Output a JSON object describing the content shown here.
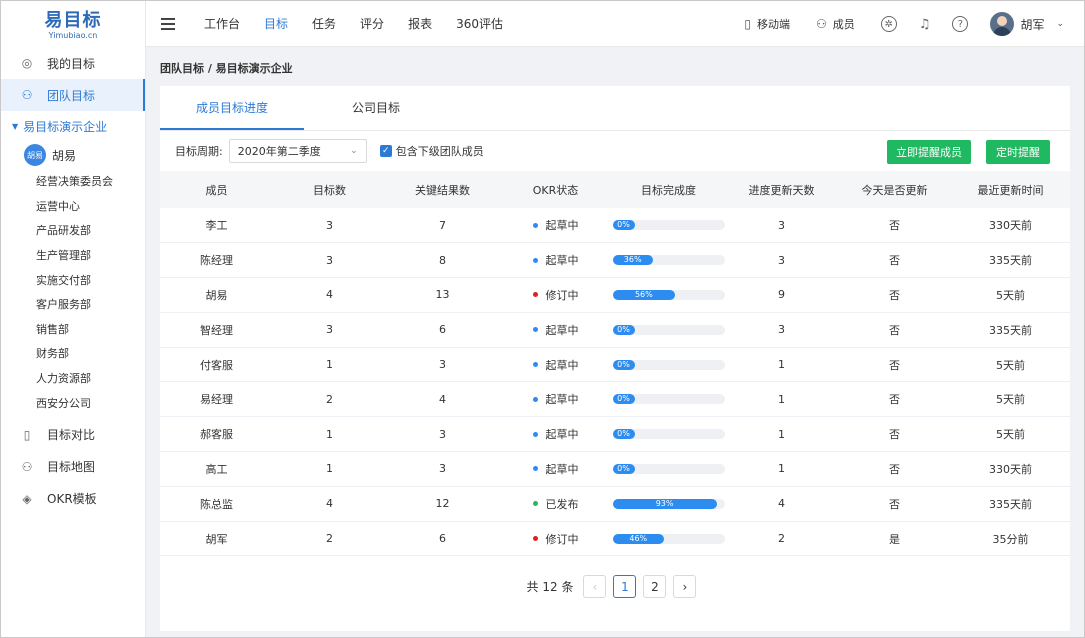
{
  "logo": {
    "title": "易目标",
    "subtitle": "Yimubiao.cn"
  },
  "sidebar": {
    "items_top": [
      {
        "label": "我的目标",
        "icon": "target-icon"
      },
      {
        "label": "团队目标",
        "icon": "team-icon"
      }
    ],
    "org": {
      "label": "易目标演示企业",
      "user_avatar": "胡易",
      "user_name": "胡易"
    },
    "departments": [
      "经营决策委员会",
      "运营中心",
      "产品研发部",
      "生产管理部",
      "实施交付部",
      "客户服务部",
      "销售部",
      "财务部",
      "人力资源部",
      "西安分公司"
    ],
    "items_bottom": [
      {
        "label": "目标对比",
        "icon": "book-icon"
      },
      {
        "label": "目标地图",
        "icon": "map-icon"
      },
      {
        "label": "OKR模板",
        "icon": "layers-icon"
      }
    ]
  },
  "topnav": [
    "工作台",
    "目标",
    "任务",
    "评分",
    "报表",
    "360评估"
  ],
  "topright": {
    "mobile": "移动端",
    "members": "成员",
    "user": "胡军"
  },
  "breadcrumb": "团队目标 / 易目标演示企业",
  "tabs": [
    "成员目标进度",
    "公司目标"
  ],
  "filter": {
    "label": "目标周期:",
    "period": "2020年第二季度",
    "checkbox": "包含下级团队成员",
    "btn_remind": "立即提醒成员",
    "btn_schedule": "定时提醒"
  },
  "table": {
    "headers": [
      "成员",
      "目标数",
      "关键结果数",
      "OKR状态",
      "目标完成度",
      "进度更新天数",
      "今天是否更新",
      "最近更新时间"
    ],
    "rows": [
      {
        "name": "李工",
        "goals": "3",
        "krs": "7",
        "status": "起草中",
        "status_color": "#2d8cf0",
        "progress": 0,
        "progress_label": "0%",
        "days": "3",
        "today": "否",
        "last": "330天前"
      },
      {
        "name": "陈经理",
        "goals": "3",
        "krs": "8",
        "status": "起草中",
        "status_color": "#2d8cf0",
        "progress": 36,
        "progress_label": "36%",
        "days": "3",
        "today": "否",
        "last": "335天前"
      },
      {
        "name": "胡易",
        "goals": "4",
        "krs": "13",
        "status": "修订中",
        "status_color": "#e02020",
        "progress": 56,
        "progress_label": "56%",
        "days": "9",
        "today": "否",
        "last": "5天前"
      },
      {
        "name": "智经理",
        "goals": "3",
        "krs": "6",
        "status": "起草中",
        "status_color": "#2d8cf0",
        "progress": 0,
        "progress_label": "0%",
        "days": "3",
        "today": "否",
        "last": "335天前"
      },
      {
        "name": "付客服",
        "goals": "1",
        "krs": "3",
        "status": "起草中",
        "status_color": "#2d8cf0",
        "progress": 0,
        "progress_label": "0%",
        "days": "1",
        "today": "否",
        "last": "5天前"
      },
      {
        "name": "易经理",
        "goals": "2",
        "krs": "4",
        "status": "起草中",
        "status_color": "#2d8cf0",
        "progress": 0,
        "progress_label": "0%",
        "days": "1",
        "today": "否",
        "last": "5天前"
      },
      {
        "name": "郝客服",
        "goals": "1",
        "krs": "3",
        "status": "起草中",
        "status_color": "#2d8cf0",
        "progress": 0,
        "progress_label": "0%",
        "days": "1",
        "today": "否",
        "last": "5天前"
      },
      {
        "name": "高工",
        "goals": "1",
        "krs": "3",
        "status": "起草中",
        "status_color": "#2d8cf0",
        "progress": 0,
        "progress_label": "0%",
        "days": "1",
        "today": "否",
        "last": "330天前"
      },
      {
        "name": "陈总监",
        "goals": "4",
        "krs": "12",
        "status": "已发布",
        "status_color": "#1eb960",
        "progress": 93,
        "progress_label": "93%",
        "days": "4",
        "today": "否",
        "last": "335天前"
      },
      {
        "name": "胡军",
        "goals": "2",
        "krs": "6",
        "status": "修订中",
        "status_color": "#e02020",
        "progress": 46,
        "progress_label": "46%",
        "days": "2",
        "today": "是",
        "last": "35分前"
      }
    ]
  },
  "pager": {
    "total": "共 12 条",
    "pages": [
      "1",
      "2"
    ],
    "current": "1"
  },
  "colors": {
    "accent": "#2d7ad6",
    "green": "#1eb960"
  }
}
